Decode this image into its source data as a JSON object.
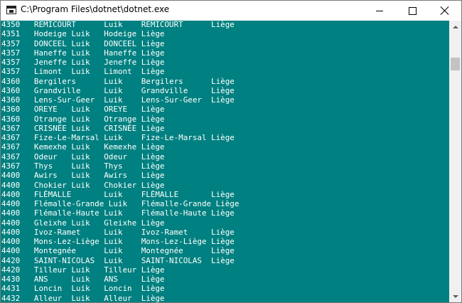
{
  "window": {
    "title": "C:\\Program Files\\dotnet\\dotnet.exe",
    "icon": "console-app-icon",
    "controls": [
      "minimize-icon",
      "maximize-icon",
      "close-icon"
    ]
  },
  "colors": {
    "console_background": "#008080",
    "console_text": "#ffffff",
    "titlebar": "#ffffff",
    "scrollbar": "#f0f0f0"
  },
  "console": {
    "lines": [
      "4350   REMICOURT      Luik    REMICOURT      Liège",
      "4351   Hodeige Luik   Hodeige Liège",
      "4357   DONCEEL Luik   DONCEEL Liège",
      "4357   Haneffe Luik   Haneffe Liège",
      "4357   Jeneffe Luik   Jeneffe Liège",
      "4357   Limont  Luik   Limont  Liège",
      "4360   Bergilers      Luik    Bergilers      Liège",
      "4360   Grandville     Luik    Grandville     Liège",
      "4360   Lens-Sur-Geer  Luik    Lens-Sur-Geer  Liège",
      "4360   OREYE   Luik   OREYE   Liège",
      "4360   Otrange Luik   Otrange Liège",
      "4367   CRISNÉE Luik   CRISNÉE Liège",
      "4367   Fize-Le-Marsal Luik    Fize-Le-Marsal Liège",
      "4367   Kemexhe Luik   Kemexhe Liège",
      "4367   Odeur   Luik   Odeur   Liège",
      "4367   Thys    Luik   Thys    Liège",
      "4400   Awirs   Luik   Awirs   Liège",
      "4400   Chokier Luik   Chokier Liège",
      "4400   FLÉMALLE       Luik    FLÉMALLE       Liège",
      "4400   Flémalle-Grande Luik   Flémalle-Grande Liège",
      "4400   Flémalle-Haute Luik    Flémalle-Haute Liège",
      "4400   Gleixhe Luik   Gleixhe Liège",
      "4400   Ivoz-Ramet     Luik    Ivoz-Ramet     Liège",
      "4400   Mons-Lez-Liège Luik    Mons-Lez-Liège Liège",
      "4400   Montegnée      Luik    Montegnée      Liège",
      "4420   SAINT-NICOLAS  Luik    SAINT-NICOLAS  Liège",
      "4420   Tilleur Luik   Tilleur Liège",
      "4430   ANS     Luik   ANS     Liège",
      "4431   Loncin  Luik   Loncin  Liège",
      "4432   Alleur  Luik   Alleur  Liège"
    ]
  }
}
